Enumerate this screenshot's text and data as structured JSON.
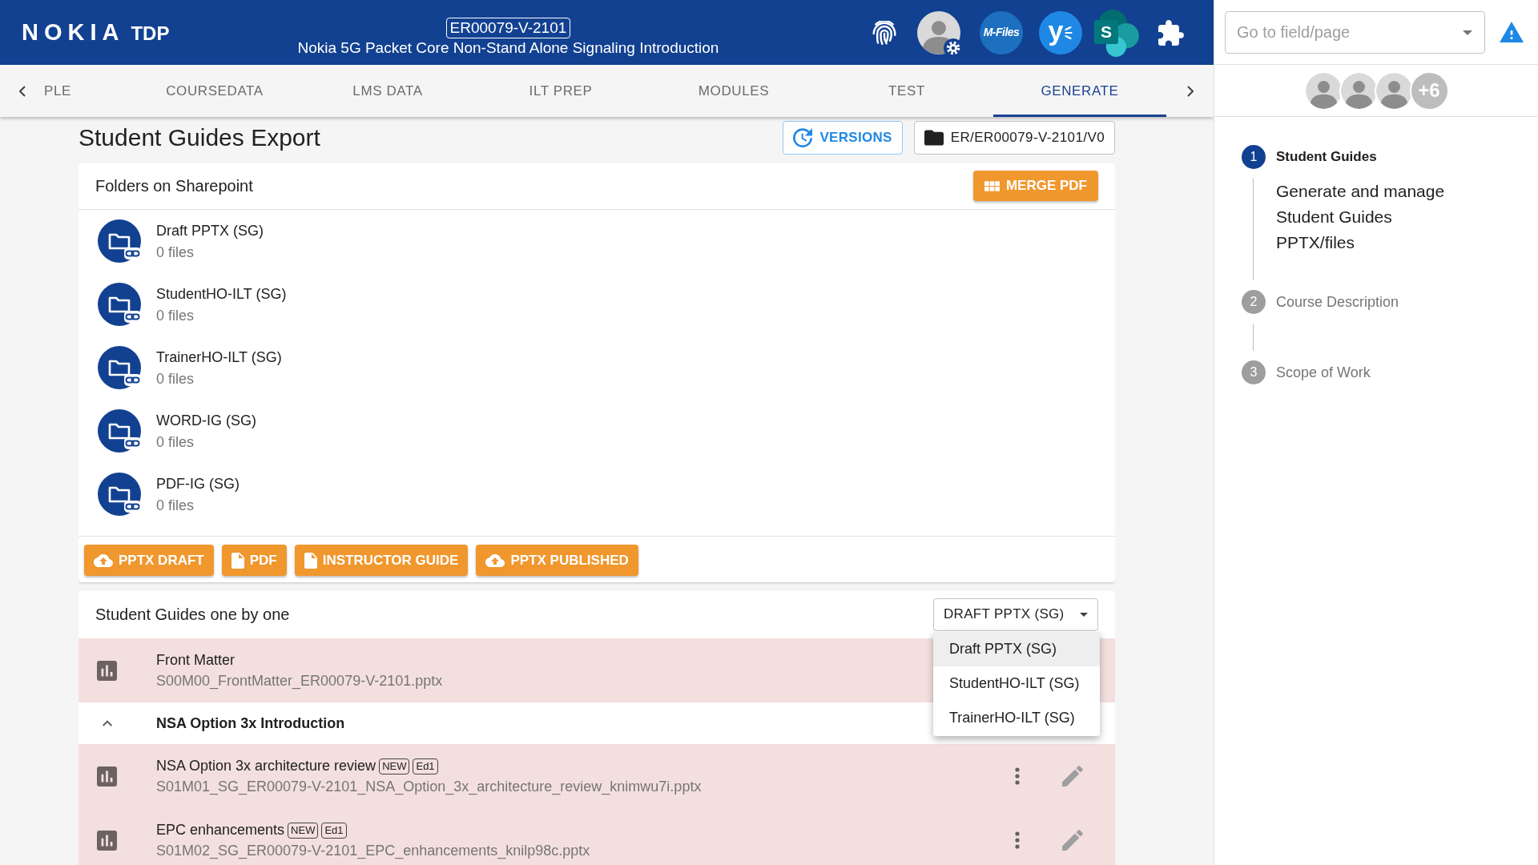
{
  "header": {
    "logo": "NOKIA",
    "product": "TDP",
    "course_code": "ER00079-V-2101",
    "course_title": "Nokia 5G Packet Core Non-Stand Alone Signaling Introduction",
    "apps": [
      {
        "kind": "mfiles",
        "label": "M-Files"
      },
      {
        "kind": "yammer",
        "label": "y"
      },
      {
        "kind": "sharepoint",
        "label": "S"
      }
    ]
  },
  "tabs": [
    {
      "label": "PLE",
      "selected": false
    },
    {
      "label": "COURSEDATA",
      "selected": false
    },
    {
      "label": "LMS DATA",
      "selected": false
    },
    {
      "label": "ILT PREP",
      "selected": false
    },
    {
      "label": "MODULES",
      "selected": false
    },
    {
      "label": "TEST",
      "selected": false
    },
    {
      "label": "GENERATE",
      "selected": true
    }
  ],
  "page": {
    "title": "Student Guides Export",
    "versions_button": "VERSIONS",
    "path_button": "ER/ER00079-V-2101/V0"
  },
  "folders_card": {
    "title": "Folders on Sharepoint",
    "merge_button": "MERGE PDF",
    "folders": [
      {
        "name": "Draft PPTX (SG)",
        "count": "0 files"
      },
      {
        "name": "StudentHO-ILT (SG)",
        "count": "0 files"
      },
      {
        "name": "TrainerHO-ILT (SG)",
        "count": "0 files"
      },
      {
        "name": "WORD-IG (SG)",
        "count": "0 files"
      },
      {
        "name": "PDF-IG (SG)",
        "count": "0 files"
      }
    ],
    "actions": [
      {
        "kind": "upload",
        "label": "PPTX DRAFT"
      },
      {
        "kind": "document",
        "label": "PDF"
      },
      {
        "kind": "document",
        "label": "INSTRUCTOR GUIDE"
      },
      {
        "kind": "upload",
        "label": "PPTX PUBLISHED"
      }
    ]
  },
  "guides_card": {
    "title": "Student Guides one by one",
    "filter": {
      "value": "DRAFT PPTX (SG)",
      "open": true,
      "options": [
        {
          "label": "Draft PPTX (SG)",
          "selected": true
        },
        {
          "label": "StudentHO-ILT (SG)",
          "selected": false
        },
        {
          "label": "TrainerHO-ILT (SG)",
          "selected": false
        }
      ]
    },
    "items": [
      {
        "kind": "file",
        "title": "Front Matter",
        "filename": "S00M00_FrontMatter_ER00079-V-2101.pptx",
        "highlighted": true
      },
      {
        "kind": "group",
        "title": "NSA Option 3x Introduction",
        "expanded": true,
        "children": [
          {
            "kind": "file",
            "title": "NSA Option 3x architecture review",
            "badges": [
              "NEW",
              "Ed1"
            ],
            "filename": "S01M01_SG_ER00079-V-2101_NSA_Option_3x_architecture_review_knimwu7i.pptx",
            "highlighted": true,
            "actions": true
          },
          {
            "kind": "file",
            "title": "EPC enhancements",
            "badges": [
              "NEW",
              "Ed1"
            ],
            "filename": "S01M02_SG_ER00079-V-2101_EPC_enhancements_knilp98c.pptx",
            "highlighted": true,
            "actions": true
          }
        ]
      }
    ]
  },
  "side_panel": {
    "goto_field": {
      "placeholder": "Go to field/page"
    },
    "collaborators": [
      {
        "kind": "avatar"
      },
      {
        "kind": "avatar"
      },
      {
        "kind": "avatar"
      },
      {
        "kind": "more",
        "label": "+6"
      }
    ],
    "stepper": [
      {
        "number": "1",
        "title": "Student Guides",
        "description": "Generate and manage Student Guides PPTX/files",
        "active": true
      },
      {
        "number": "2",
        "title": "Course Description",
        "active": false
      },
      {
        "number": "3",
        "title": "Scope of Work",
        "active": false
      }
    ]
  }
}
